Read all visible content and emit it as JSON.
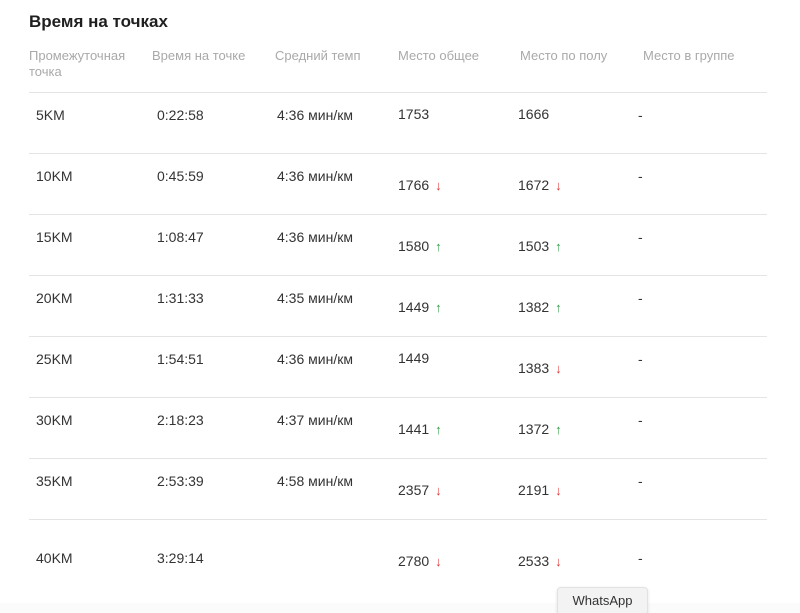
{
  "title": "Время на точках",
  "headers": [
    "Промежуточная точка",
    "Время на точке",
    "Средний темп",
    "Место общее",
    "Место по полу",
    "Место в группе"
  ],
  "rows": [
    {
      "point": "5KM",
      "time": "0:22:58",
      "pace": "4:36 мин/км",
      "overall": "1753",
      "overall_trend": "",
      "gender": "1666",
      "gender_trend": "",
      "group": "-"
    },
    {
      "point": "10KM",
      "time": "0:45:59",
      "pace": "4:36 мин/км",
      "overall": "1766",
      "overall_trend": "down",
      "gender": "1672",
      "gender_trend": "down",
      "group": "-"
    },
    {
      "point": "15KM",
      "time": "1:08:47",
      "pace": "4:36 мин/км",
      "overall": "1580",
      "overall_trend": "up",
      "gender": "1503",
      "gender_trend": "up",
      "group": "-"
    },
    {
      "point": "20KM",
      "time": "1:31:33",
      "pace": "4:35 мин/км",
      "overall": "1449",
      "overall_trend": "up",
      "gender": "1382",
      "gender_trend": "up",
      "group": "-"
    },
    {
      "point": "25KM",
      "time": "1:54:51",
      "pace": "4:36 мин/км",
      "overall": "1449",
      "overall_trend": "",
      "gender": "1383",
      "gender_trend": "down",
      "group": "-"
    },
    {
      "point": "30KM",
      "time": "2:18:23",
      "pace": "4:37 мин/км",
      "overall": "1441",
      "overall_trend": "up",
      "gender": "1372",
      "gender_trend": "up",
      "group": "-"
    },
    {
      "point": "35KM",
      "time": "2:53:39",
      "pace": "4:58 мин/км",
      "overall": "2357",
      "overall_trend": "down",
      "gender": "2191",
      "gender_trend": "down",
      "group": "-"
    },
    {
      "point": "40KM",
      "time": "3:29:14",
      "pace": "",
      "overall": "2780",
      "overall_trend": "down",
      "gender": "2533",
      "gender_trend": "down",
      "group": "-"
    }
  ],
  "arrows": {
    "up": "↑",
    "down": "↓"
  },
  "colors": {
    "up": "#2f9e44",
    "down": "#e03a3a"
  },
  "whatsapp_label": "WhatsApp"
}
